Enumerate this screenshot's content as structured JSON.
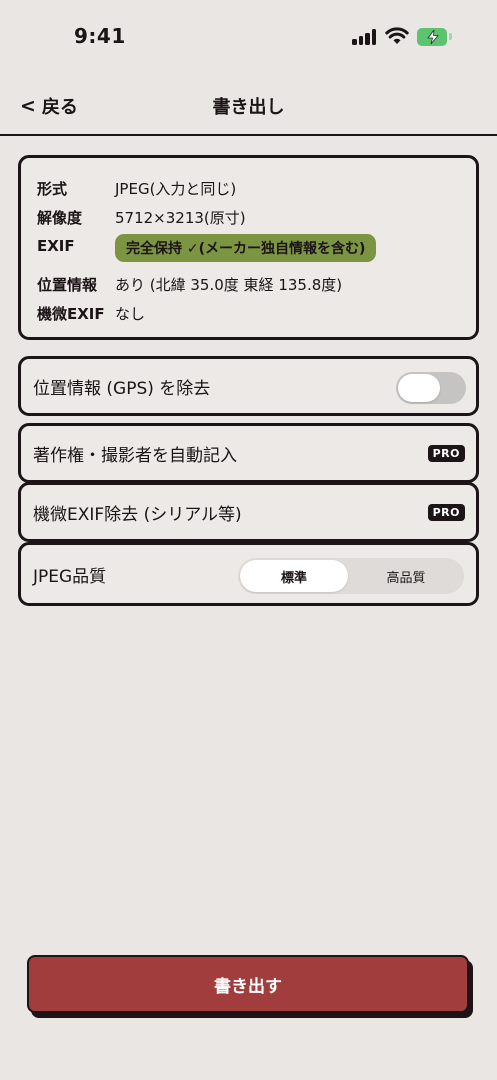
{
  "status_bar": {
    "time": "9:41"
  },
  "nav": {
    "back_label": "戻る",
    "back_chevron": "<",
    "title": "書き出し"
  },
  "info": {
    "rows": [
      {
        "key": "形式",
        "value": "JPEG(入力と同じ)"
      },
      {
        "key": "解像度",
        "value": "5712×3213(原寸)"
      },
      {
        "key": "EXIF",
        "value": "完全保持 ✓(メーカー独自情報を含む)"
      },
      {
        "key": "位置情報",
        "value": "あり (北緯 35.0度 東経 135.8度)"
      },
      {
        "key": "機微EXIF",
        "value": "なし"
      }
    ],
    "badge_color": "#7c9542"
  },
  "options": {
    "remove_gps": {
      "label": "位置情報 (GPS) を除去",
      "toggle_on": false
    },
    "auto_copyright": {
      "label": "著作権・撮影者を自動記入",
      "badge": "PRO"
    },
    "remove_sensitive_exif": {
      "label": "機微EXIF除去 (シリアル等)",
      "badge": "PRO"
    },
    "jpeg_quality": {
      "label": "JPEG品質",
      "options": [
        "標準",
        "高品質"
      ],
      "selected": "標準"
    }
  },
  "export": {
    "label": "書き出す",
    "color": "#a13d3d"
  }
}
